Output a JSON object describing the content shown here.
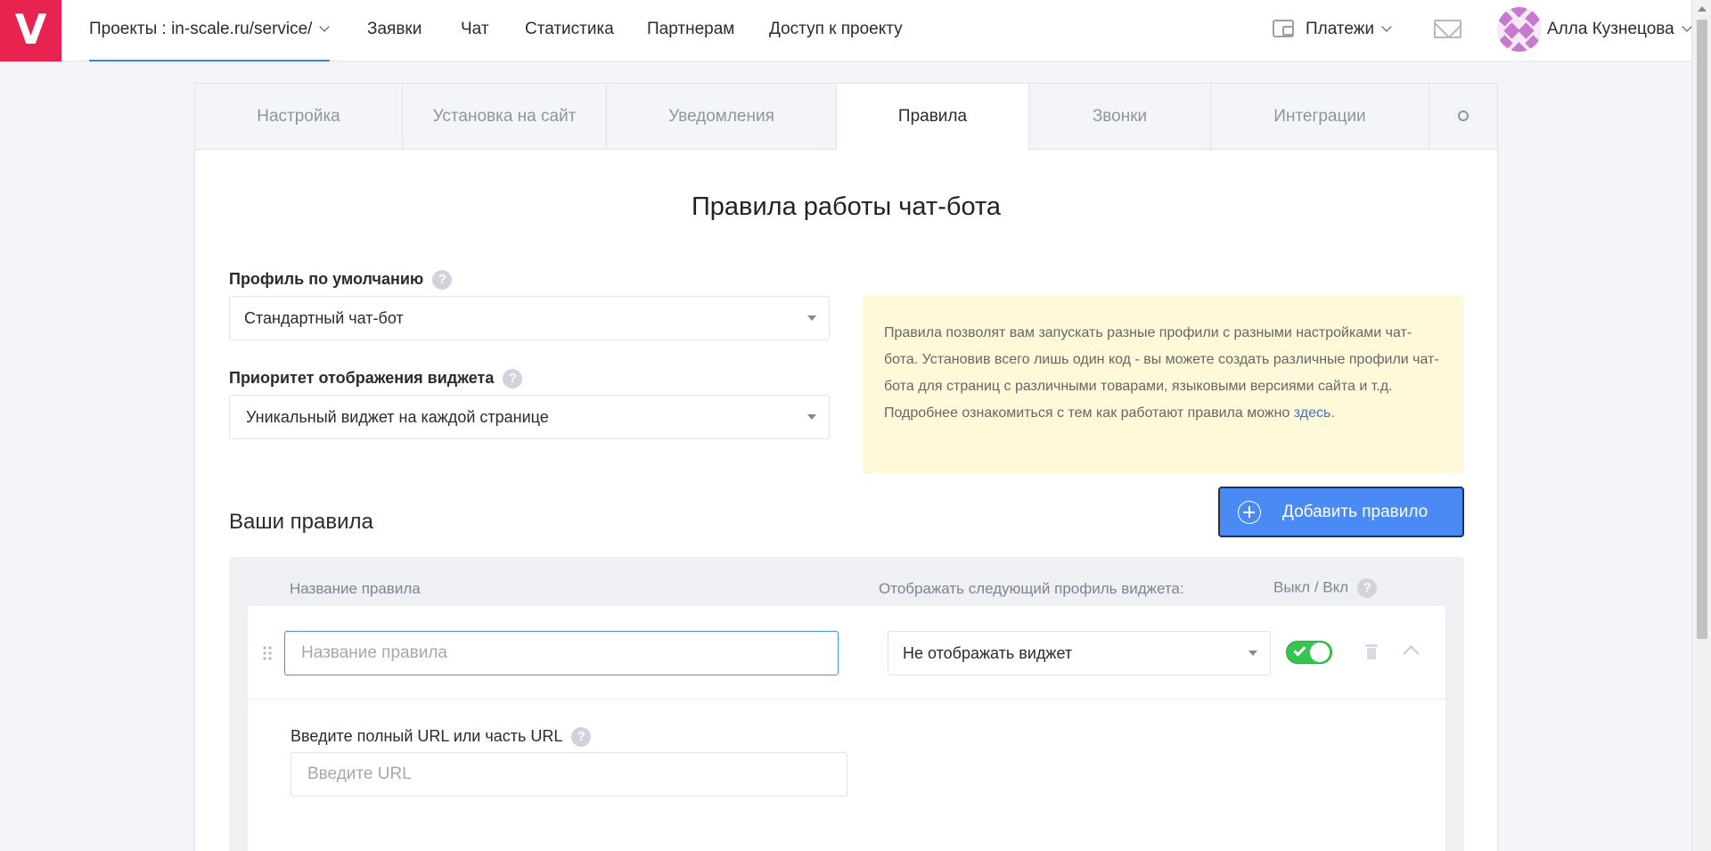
{
  "header": {
    "logo": "V",
    "nav": [
      {
        "label": "Проекты : in-scale.ru/service/"
      },
      {
        "label": "Заявки"
      },
      {
        "label": "Чат"
      },
      {
        "label": "Статистика"
      },
      {
        "label": "Партнерам"
      },
      {
        "label": "Доступ к проекту"
      }
    ],
    "payments_label": "Платежи",
    "user_name": "Алла Кузнецова"
  },
  "tabs": [
    {
      "label": "Настройка"
    },
    {
      "label": "Установка на сайт"
    },
    {
      "label": "Уведомления"
    },
    {
      "label": "Правила"
    },
    {
      "label": "Звонки"
    },
    {
      "label": "Интеграции"
    }
  ],
  "active_tab": "Правила",
  "page": {
    "title": "Правила работы чат-бота",
    "default_profile": {
      "label": "Профиль по умолчанию",
      "value": "Стандартный чат-бот"
    },
    "widget_priority": {
      "label": "Приоритет отображения виджета",
      "value": "Уникальный виджет на каждой странице"
    },
    "info": {
      "text": "Правила позволят вам запускать разные профили с разными настройками чат-бота. Установив всего лишь один код - вы можете создать различные профили чат-бота для страниц с различными товарами, языковыми версиями сайта и т.д. Подробнее ознакомиться с тем как работают правила можно ",
      "link": "здесь",
      "end": "."
    },
    "add_rule_label": "Добавить правило",
    "rules_title": "Ваши правила"
  },
  "rules_table": {
    "col_name": "Название правила",
    "col_profile": "Отображать следующий профиль виджета:",
    "col_toggle": "Выкл / Вкл",
    "rule": {
      "name_placeholder": "Название правила",
      "profile_value": "Не отображать виджет",
      "enabled": true,
      "url_label": "Введите полный URL или часть URL",
      "url_placeholder": "Введите URL"
    }
  },
  "colors": {
    "brand": "#e8234f",
    "accent": "#4a8af4",
    "toggle_on": "#35c650",
    "info_bg": "#fff9d9"
  }
}
